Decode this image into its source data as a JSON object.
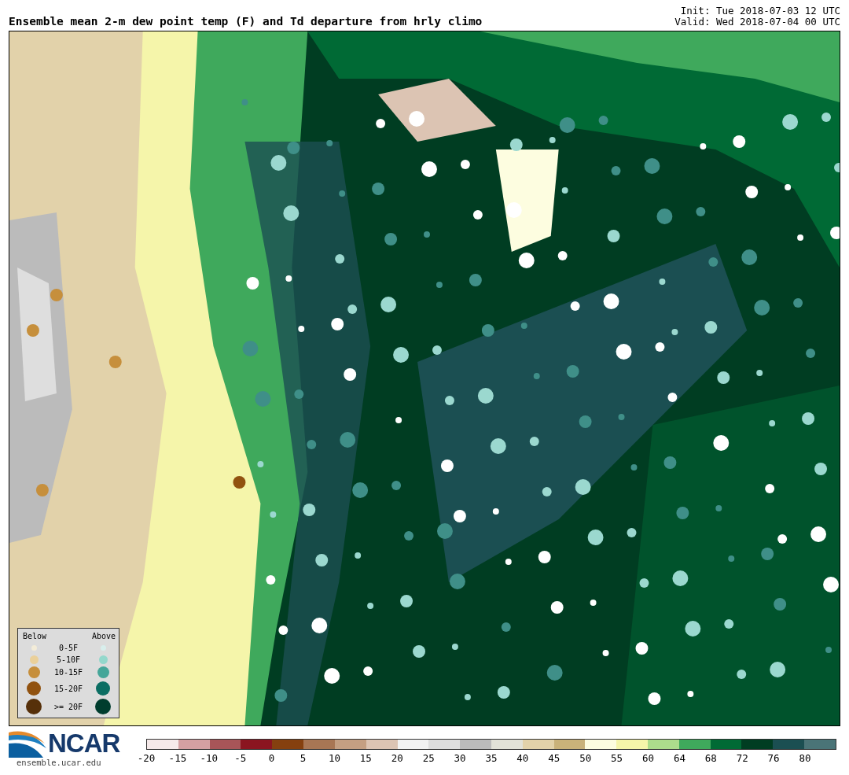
{
  "header": {
    "title": "Ensemble mean 2-m dew point temp (F) and Td departure from hrly climo",
    "init": "Init: Tue 2018-07-03 12 UTC",
    "valid": "Valid: Wed 2018-07-04 00 UTC"
  },
  "legend": {
    "below_label": "Below",
    "above_label": "Above",
    "rows": [
      {
        "label": "0-5F",
        "below": {
          "color": "#f3ecd8"
        },
        "above": {
          "color": "#d8eeec"
        }
      },
      {
        "label": "5-10F",
        "below": {
          "color": "#ead09a"
        },
        "above": {
          "color": "#94d8cc"
        }
      },
      {
        "label": "10-15F",
        "below": {
          "color": "#c68f3c"
        },
        "above": {
          "color": "#45a699"
        }
      },
      {
        "label": "15-20F",
        "below": {
          "color": "#91520f"
        },
        "above": {
          "color": "#0b6e63"
        }
      },
      {
        "label": ">= 20F",
        "below": {
          "color": "#56300a"
        },
        "above": {
          "color": "#003d2e"
        }
      }
    ]
  },
  "footer": {
    "logo": "NCAR",
    "site": "ensemble.ucar.edu"
  },
  "colorbar": {
    "segments": [
      {
        "color": "#f5e9e9"
      },
      {
        "color": "#d4a0a2"
      },
      {
        "color": "#a85558"
      },
      {
        "color": "#8b1520"
      },
      {
        "color": "#85400f"
      },
      {
        "color": "#a87654"
      },
      {
        "color": "#c49f82"
      },
      {
        "color": "#dcc4b3"
      },
      {
        "color": "#f2f2f2"
      },
      {
        "color": "#dedede"
      },
      {
        "color": "#bbbbbb"
      },
      {
        "color": "#e2e2d8"
      },
      {
        "color": "#e2d2aa"
      },
      {
        "color": "#c9b27a"
      },
      {
        "color": "#fdfde0"
      },
      {
        "color": "#f5f5aa"
      },
      {
        "color": "#acdc8c"
      },
      {
        "color": "#3fa95c"
      },
      {
        "color": "#006a35"
      },
      {
        "color": "#003d22"
      },
      {
        "color": "#1b4f52"
      },
      {
        "color": "#4a7477"
      }
    ],
    "ticks": [
      "-20",
      "-15",
      "-10",
      "-5",
      "0",
      "5",
      "10",
      "15",
      "20",
      "25",
      "30",
      "35",
      "40",
      "45",
      "50",
      "55",
      "60",
      "64",
      "68",
      "72",
      "76",
      "80"
    ]
  }
}
